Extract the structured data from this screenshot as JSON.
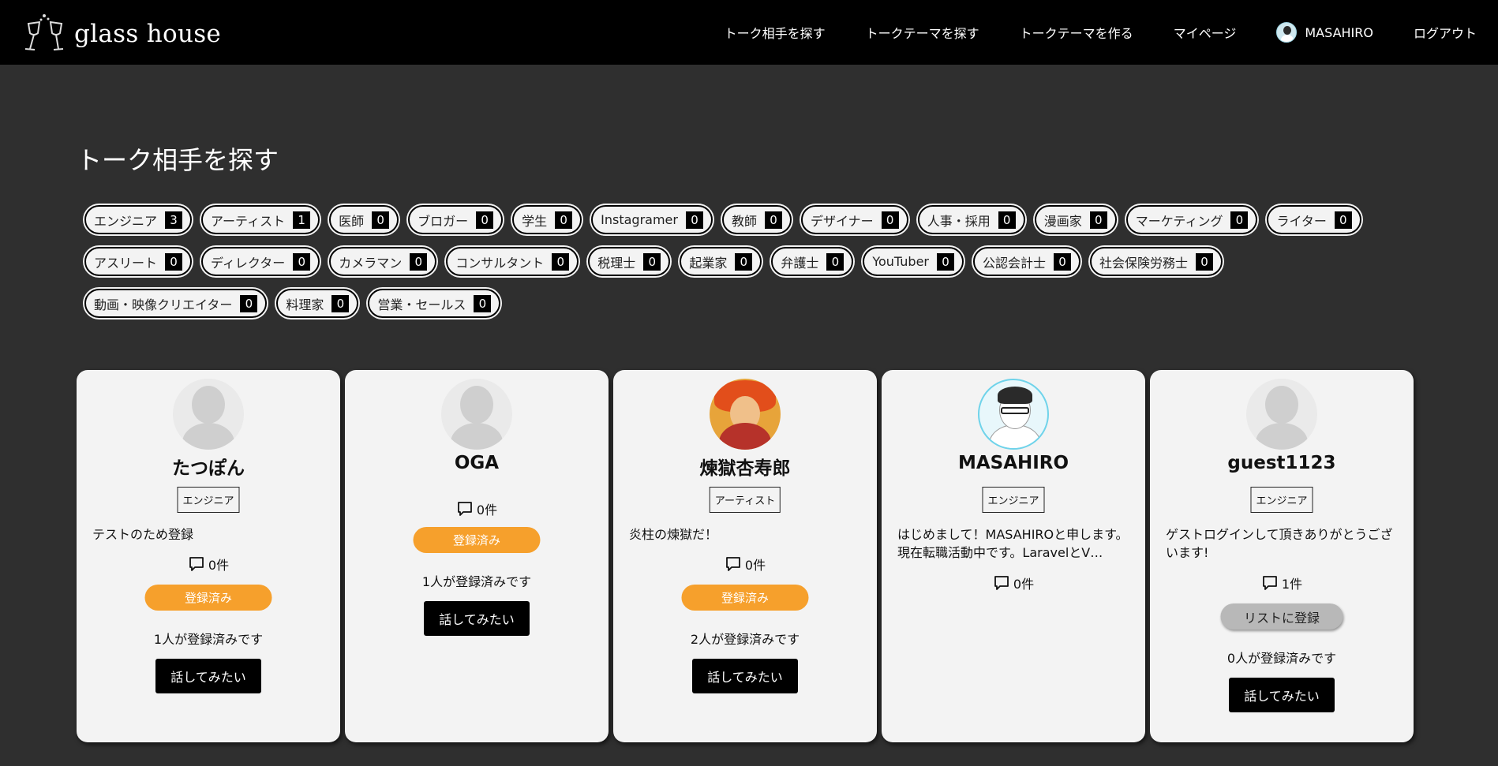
{
  "header": {
    "logo_text": "glass house",
    "nav": [
      "トーク相手を探す",
      "トークテーマを探す",
      "トークテーマを作る",
      "マイページ",
      "MASAHIRO",
      "ログアウト"
    ]
  },
  "page_title": "トーク相手を探す",
  "tags": {
    "row1": [
      {
        "label": "エンジニア",
        "count": "3"
      },
      {
        "label": "アーティスト",
        "count": "1"
      },
      {
        "label": "医師",
        "count": "0"
      },
      {
        "label": "ブロガー",
        "count": "0"
      },
      {
        "label": "学生",
        "count": "0"
      },
      {
        "label": "Instagramer",
        "count": "0"
      },
      {
        "label": "教師",
        "count": "0"
      },
      {
        "label": "デザイナー",
        "count": "0"
      },
      {
        "label": "人事・採用",
        "count": "0"
      },
      {
        "label": "漫画家",
        "count": "0"
      },
      {
        "label": "マーケティング",
        "count": "0"
      },
      {
        "label": "ライター",
        "count": "0"
      }
    ],
    "row2": [
      {
        "label": "アスリート",
        "count": "0"
      },
      {
        "label": "ディレクター",
        "count": "0"
      },
      {
        "label": "カメラマン",
        "count": "0"
      },
      {
        "label": "コンサルタント",
        "count": "0"
      },
      {
        "label": "税理士",
        "count": "0"
      },
      {
        "label": "起業家",
        "count": "0"
      },
      {
        "label": "弁護士",
        "count": "0"
      },
      {
        "label": "YouTuber",
        "count": "0"
      },
      {
        "label": "公認会計士",
        "count": "0"
      },
      {
        "label": "社会保険労務士",
        "count": "0"
      }
    ],
    "row3": [
      {
        "label": "動画・映像クリエイター",
        "count": "0"
      },
      {
        "label": "料理家",
        "count": "0"
      },
      {
        "label": "営業・セールス",
        "count": "0"
      }
    ]
  },
  "cards": [
    {
      "name": "たつぽん",
      "role": "エンジニア",
      "intro": "テストのため登録",
      "comments": "0件",
      "register_label": "登録済み",
      "registered_count": "1人が登録済みです",
      "talk_label": "話してみたい"
    },
    {
      "name": "OGA",
      "comments": "0件",
      "register_label": "登録済み",
      "registered_count": "1人が登録済みです",
      "talk_label": "話してみたい"
    },
    {
      "name": "煉獄杏寿郎",
      "role": "アーティスト",
      "intro": "炎柱の煉獄だ！",
      "comments": "0件",
      "register_label": "登録済み",
      "registered_count": "2人が登録済みです",
      "talk_label": "話してみたい"
    },
    {
      "name": "MASAHIRO",
      "role": "エンジニア",
      "intro": "はじめまして！MASAHIROと申します。現在転職活動中です。LaravelとV…",
      "comments": "0件"
    },
    {
      "name": "guest1123",
      "role": "エンジニア",
      "intro": "ゲストログインして頂きありがとうございます!",
      "comments": "1件",
      "register_label": "リストに登録",
      "registered_count": "0人が登録済みです",
      "talk_label": "話してみたい"
    }
  ],
  "colors": {
    "background": "#2f2f2f",
    "header": "#000000",
    "card": "#f3f3f3",
    "registered_button": "#f6a02c",
    "add_list_button": "#b8b8b8"
  }
}
